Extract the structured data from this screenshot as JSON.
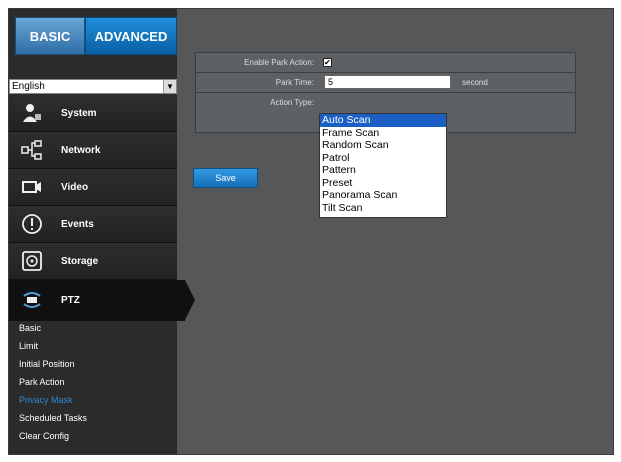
{
  "tabs": {
    "basic": "BASIC",
    "advanced": "ADVANCED"
  },
  "language": {
    "selected": "English"
  },
  "nav": [
    {
      "label": "System",
      "icon": "system-icon"
    },
    {
      "label": "Network",
      "icon": "network-icon"
    },
    {
      "label": "Video",
      "icon": "video-icon"
    },
    {
      "label": "Events",
      "icon": "events-icon"
    },
    {
      "label": "Storage",
      "icon": "storage-icon"
    },
    {
      "label": "PTZ",
      "icon": "ptz-icon"
    }
  ],
  "submenu": [
    "Basic",
    "Limit",
    "Initial Position",
    "Park Action",
    "Privacy Mask",
    "Scheduled Tasks",
    "Clear Config"
  ],
  "form": {
    "enable_label": "Enable Park Action:",
    "enable_checked": true,
    "park_time_label": "Park Time:",
    "park_time_value": "5",
    "park_time_unit": "second",
    "action_type_label": "Action Type:",
    "action_options": [
      "Auto Scan",
      "Frame Scan",
      "Random Scan",
      "Patrol",
      "Pattern",
      "Preset",
      "Panorama Scan",
      "Tilt Scan"
    ],
    "selected_action": "Auto Scan",
    "save_label": "Save"
  },
  "colors": {
    "accent": "#1d8fd8",
    "highlight": "#2e8ad6",
    "background": "#555759"
  }
}
